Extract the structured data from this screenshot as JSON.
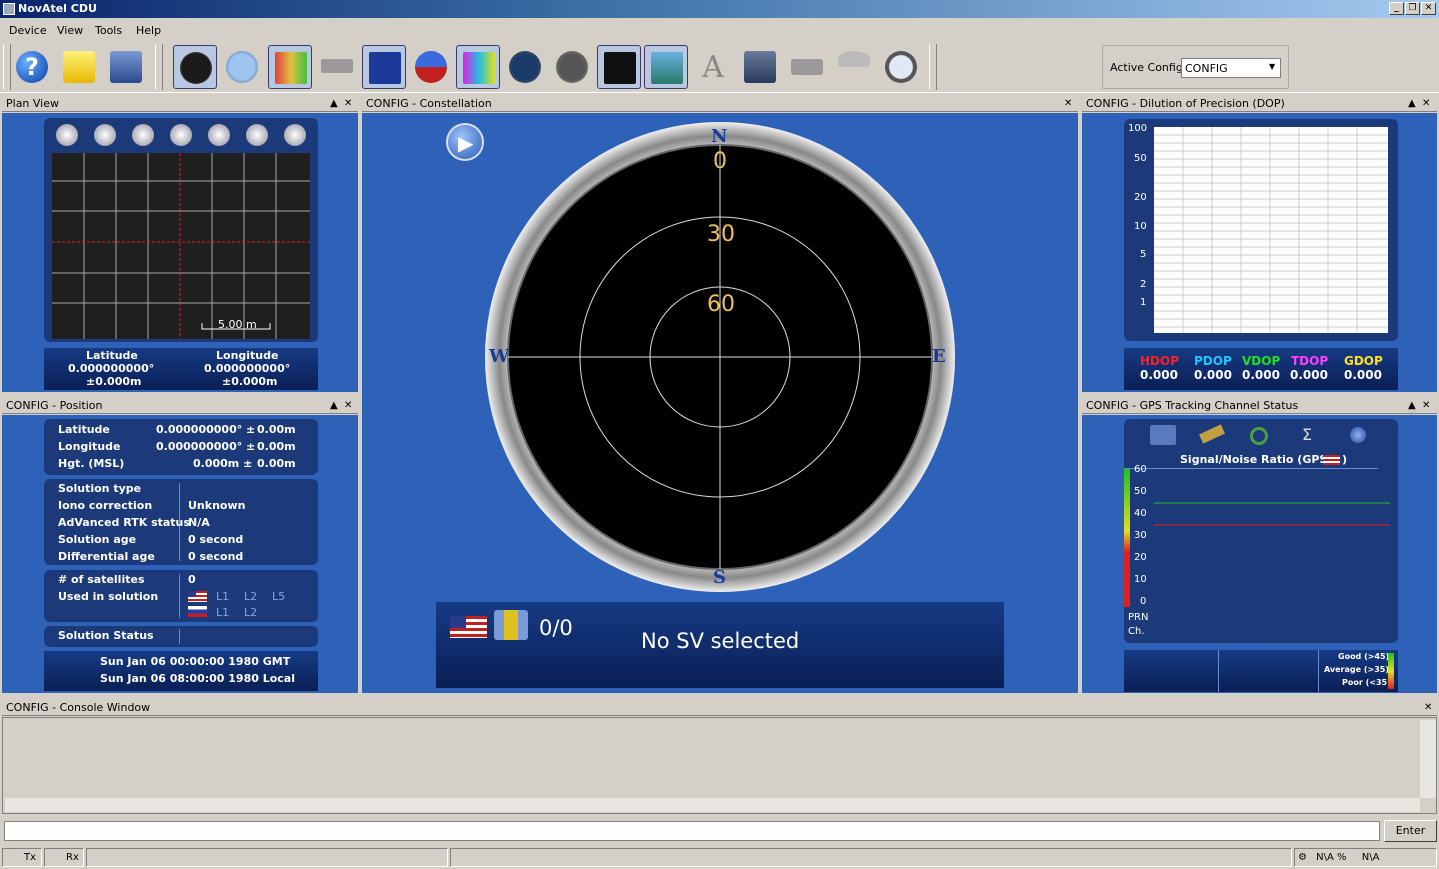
{
  "window": {
    "title": "NovAtel CDU"
  },
  "menu": [
    "Device",
    "View",
    "Tools",
    "Help"
  ],
  "toolbar": {
    "active_config_label": "Active Config",
    "active_config_value": "CONFIG"
  },
  "plan_view": {
    "title": "Plan View",
    "scale": "5.00 m",
    "latitude_label": "Latitude",
    "longitude_label": "Longitude",
    "latitude_value": "0.000000000°",
    "longitude_value": "0.000000000°",
    "latitude_err": "±0.000m",
    "longitude_err": "±0.000m"
  },
  "position": {
    "title": "CONFIG - Position",
    "lat_label": "Latitude",
    "lat_value": "0.000000000° ±",
    "lat_err": "0.00m",
    "lon_label": "Longitude",
    "lon_value": "0.000000000° ±",
    "lon_err": "0.00m",
    "hgt_label": "Hgt. (MSL)",
    "hgt_value": "0.000m ±",
    "hgt_err": "0.00m",
    "solution_type_label": "Solution type",
    "solution_type_value": "",
    "iono_label": "Iono correction",
    "iono_value": "Unknown",
    "rtk_label": "AdVanced RTK status",
    "rtk_value": "N/A",
    "sol_age_label": "Solution age",
    "sol_age_value": "0 second",
    "diff_age_label": "Differential age",
    "diff_age_value": "0 second",
    "num_sats_label": "# of satellites",
    "num_sats_value": "0",
    "used_label": "Used in solution",
    "gps_bands": [
      "L1",
      "L2",
      "L5"
    ],
    "glo_bands": [
      "L1",
      "L2"
    ],
    "status_label": "Solution Status",
    "time_gmt": "Sun Jan 06 00:00:00 1980 GMT",
    "time_local": "Sun Jan 06 08:00:00 1980 Local"
  },
  "constellation": {
    "title": "CONFIG - Constellation",
    "compass": {
      "n": "N",
      "s": "S",
      "e": "E",
      "w": "W"
    },
    "rings": [
      "0",
      "30",
      "60"
    ],
    "sv_count": "0/0",
    "sv_message": "No SV selected"
  },
  "dop": {
    "title": "CONFIG - Dilution of Precision (DOP)",
    "y_ticks": [
      "100",
      "50",
      "20",
      "10",
      "5",
      "2",
      "1"
    ],
    "labels": [
      "HDOP",
      "PDOP",
      "VDOP",
      "TDOP",
      "GDOP"
    ],
    "values": [
      "0.000",
      "0.000",
      "0.000",
      "0.000",
      "0.000"
    ],
    "colors": [
      "#ff2020",
      "#20c8ff",
      "#20e020",
      "#ff40ff",
      "#ffe020"
    ]
  },
  "tracking": {
    "title": "CONFIG - GPS Tracking Channel Status",
    "chart_title": "Signal/Noise Ratio (GPS",
    "y_ticks": [
      "60",
      "50",
      "40",
      "30",
      "20",
      "10",
      "0"
    ],
    "prn_label": "PRN",
    "ch_label": "Ch.",
    "legend": [
      "Good (>45)",
      "Average (>35)",
      "Poor (<35)"
    ]
  },
  "console": {
    "title": "CONFIG - Console Window",
    "enter_label": "Enter"
  },
  "statusbar": {
    "tx": "Tx",
    "rx": "Rx",
    "pct": "N\\A %",
    "na": "N\\A"
  }
}
